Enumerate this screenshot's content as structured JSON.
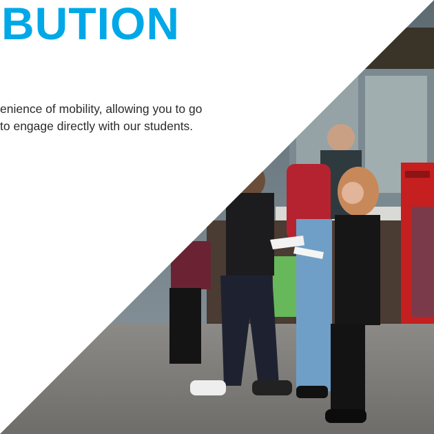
{
  "heading": "BUTION",
  "body_lines": [
    "enience of mobility, allowing you to go",
    "to engage directly with our students."
  ],
  "colors": {
    "heading": "#00a8e8",
    "background": "#ffffff",
    "body_text": "#2b2b2b"
  },
  "photo": {
    "subject": "people-on-street-distributing-flyers"
  }
}
